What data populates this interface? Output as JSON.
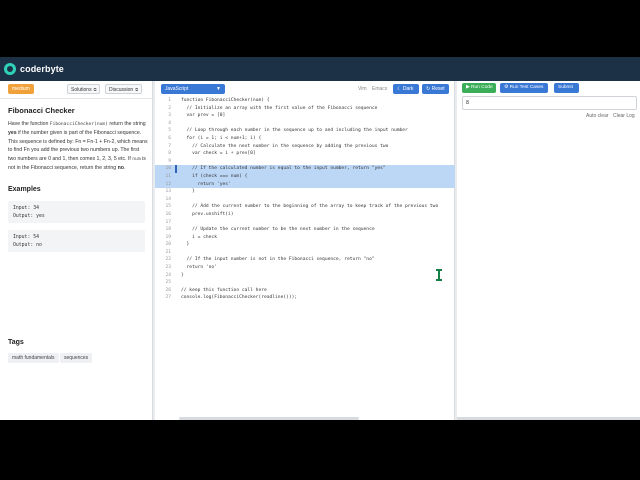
{
  "brand": {
    "name": "coderbyte"
  },
  "problem": {
    "difficulty": "medium",
    "solutions_label": "Solutions",
    "discussion_label": "Discussion",
    "title": "Fibonacci Checker",
    "desc_1": "Have the function ",
    "desc_code": "FibonacciChecker(num)",
    "desc_2": " return the string ",
    "desc_yes": "yes",
    "desc_3": " if the number given is part of the Fibonacci sequence. This sequence is defined by: Fn = Fn-1 + Fn-2, which means to find Fn you add the previous two numbers up. The first two numbers are 0 and 1, then comes 1, 2, 3, 5 etc. If ",
    "desc_code2": "num",
    "desc_4": " is not in the Fibonacci sequence, return the string ",
    "desc_no": "no",
    "desc_5": ".",
    "examples_heading": "Examples",
    "examples": [
      {
        "input": "Input: 34",
        "output": "Output: yes"
      },
      {
        "input": "Input: 54",
        "output": "Output: no"
      }
    ],
    "tags_heading": "Tags",
    "tags": [
      "math fundamentals",
      "sequences"
    ]
  },
  "editor": {
    "language": "JavaScript",
    "vim_label": "Vim",
    "emacs_label": "Emacs",
    "dark_label": "Dark",
    "reset_label": "Reset",
    "lines": [
      "function FibonacciChecker(num) {",
      "  // Initialize an array with the first value of the Fibonacci sequence",
      "  var prev = [0]",
      "",
      "  // Loop through each number in the sequence up to and including the input number",
      "  for (i = 1; i < num+1; i) {",
      "    // Calculate the next number in the sequence by adding the previous two",
      "    var check = i + prev[0]",
      "",
      "    // If the calculated number is equal to the input number, return \"yes\"",
      "    if (check === num) {",
      "      return 'yes'",
      "    }",
      "",
      "    // Add the current number to the beginning of the array to keep track of the previous two",
      "    prev.unshift(i)",
      "",
      "    // Update the current number to be the next number in the sequence",
      "    i = check",
      "  }",
      "",
      "  // If the input number is not in the Fibonacci sequence, return \"no\"",
      "  return 'no'",
      "}",
      "",
      "// keep this function call here",
      "console.log(FibonacciChecker(readline()));"
    ],
    "highlighted_lines": [
      10,
      11,
      12
    ]
  },
  "output": {
    "run_label": "Run Code",
    "tests_label": "Run Test Cases",
    "submit_label": "Submit",
    "input_value": "8",
    "autoclear_label": "Auto clear",
    "clearlog_label": "Clear Log"
  },
  "colors": {
    "topbar": "#1d3146",
    "accent_blue": "#3a78d6",
    "run_green": "#3cae59",
    "difficulty_orange": "#f0a13a",
    "selection": "#bcd6f5"
  }
}
